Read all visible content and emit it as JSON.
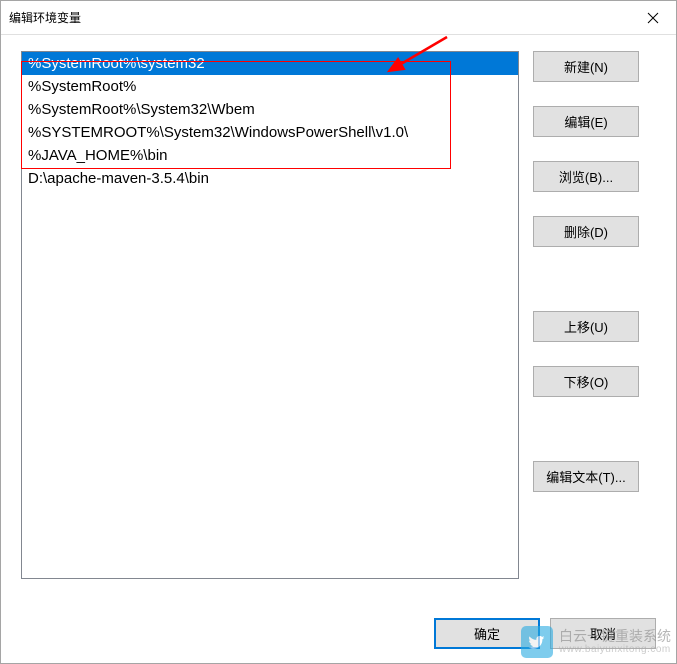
{
  "window": {
    "title": "编辑环境变量"
  },
  "list": {
    "items": [
      "%SystemRoot%\\system32",
      "%SystemRoot%",
      "%SystemRoot%\\System32\\Wbem",
      "%SYSTEMROOT%\\System32\\WindowsPowerShell\\v1.0\\",
      "%JAVA_HOME%\\bin",
      "D:\\apache-maven-3.5.4\\bin"
    ],
    "selected_index": 0
  },
  "buttons": {
    "new": "新建(N)",
    "edit": "编辑(E)",
    "browse": "浏览(B)...",
    "delete": "删除(D)",
    "move_up": "上移(U)",
    "move_down": "下移(O)",
    "edit_text": "编辑文本(T)...",
    "ok": "确定",
    "cancel": "取消"
  },
  "watermark": {
    "line1": "白云一键重装系统",
    "line2": "www.baiyunxitong.com"
  }
}
